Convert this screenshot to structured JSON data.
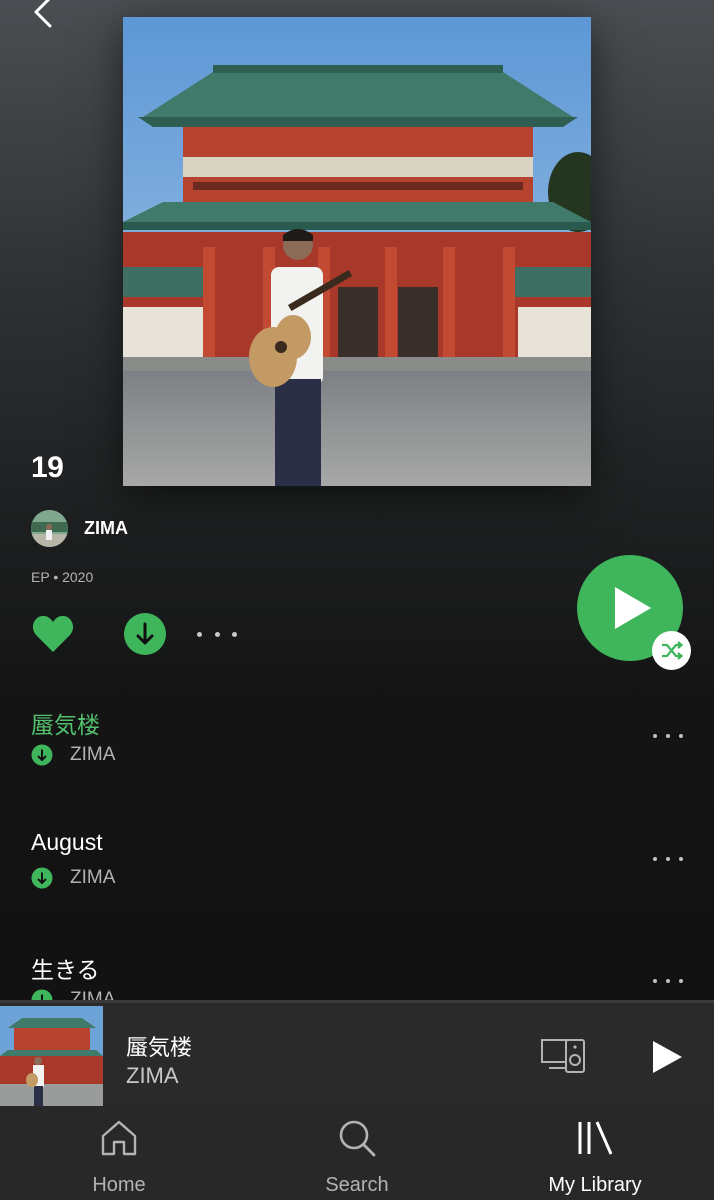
{
  "album": {
    "title": "19",
    "artist": "ZIMA",
    "meta": "EP • 2020"
  },
  "icons": {
    "back": "chevron-left-icon",
    "like": "heart-icon",
    "download": "download-icon",
    "more": "more-horizontal-icon",
    "play": "play-icon",
    "shuffle": "shuffle-icon",
    "devices": "devices-icon"
  },
  "colors": {
    "accent": "#3fb65c",
    "background": "#121212",
    "player": "#2a2a2a",
    "nav": "#282828"
  },
  "tracks": [
    {
      "title": "蜃気楼",
      "artist": "ZIMA",
      "downloaded": true,
      "playing": true
    },
    {
      "title": "August",
      "artist": "ZIMA",
      "downloaded": true,
      "playing": false
    },
    {
      "title": "生きる",
      "artist": "ZIMA",
      "downloaded": true,
      "playing": false
    }
  ],
  "now_playing": {
    "title": "蜃気楼",
    "artist": "ZIMA"
  },
  "nav": {
    "items": [
      {
        "label": "Home",
        "icon": "home-icon",
        "active": false
      },
      {
        "label": "Search",
        "icon": "search-icon",
        "active": false
      },
      {
        "label": "My Library",
        "icon": "library-icon",
        "active": true
      }
    ]
  }
}
